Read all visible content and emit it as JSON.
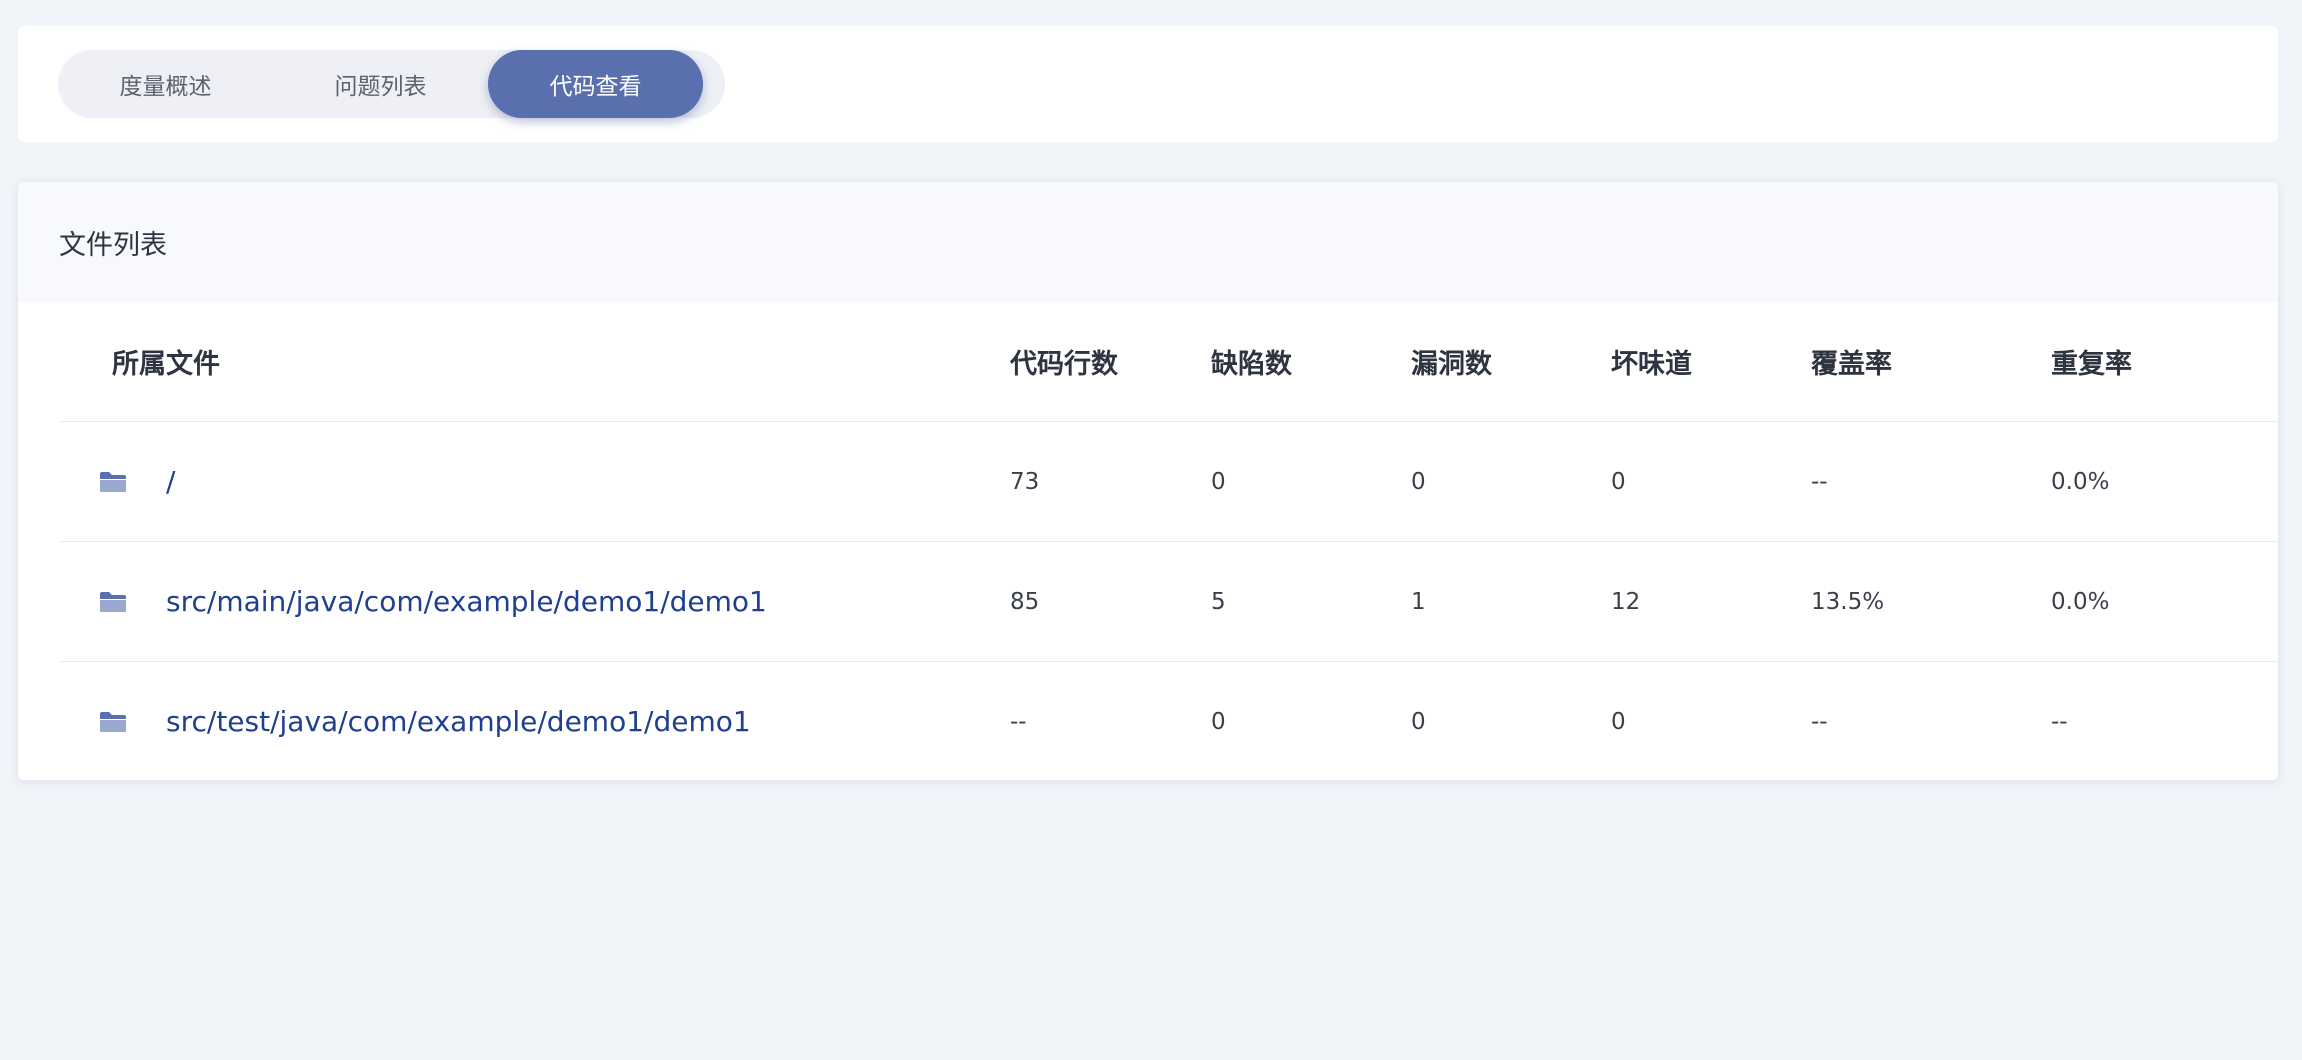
{
  "tabs": [
    {
      "label": "度量概述",
      "active": false
    },
    {
      "label": "问题列表",
      "active": false
    },
    {
      "label": "代码查看",
      "active": true
    }
  ],
  "file_list": {
    "title": "文件列表",
    "columns": [
      "所属文件",
      "代码行数",
      "缺陷数",
      "漏洞数",
      "坏味道",
      "覆盖率",
      "重复率"
    ],
    "rows": [
      {
        "icon": "folder-icon",
        "file": "/",
        "lines": "73",
        "defects": "0",
        "vulnerabilities": "0",
        "code_smells": "0",
        "coverage": "--",
        "duplication": "0.0%"
      },
      {
        "icon": "folder-icon",
        "file": "src/main/java/com/example/demo1/demo1",
        "lines": "85",
        "defects": "5",
        "vulnerabilities": "1",
        "code_smells": "12",
        "coverage": "13.5%",
        "duplication": "0.0%"
      },
      {
        "icon": "folder-icon",
        "file": "src/test/java/com/example/demo1/demo1",
        "lines": "--",
        "defects": "0",
        "vulnerabilities": "0",
        "code_smells": "0",
        "coverage": "--",
        "duplication": "--"
      }
    ]
  },
  "colors": {
    "accent": "#5a6fae",
    "link": "#1f3f8f",
    "background": "#f1f4f9"
  }
}
